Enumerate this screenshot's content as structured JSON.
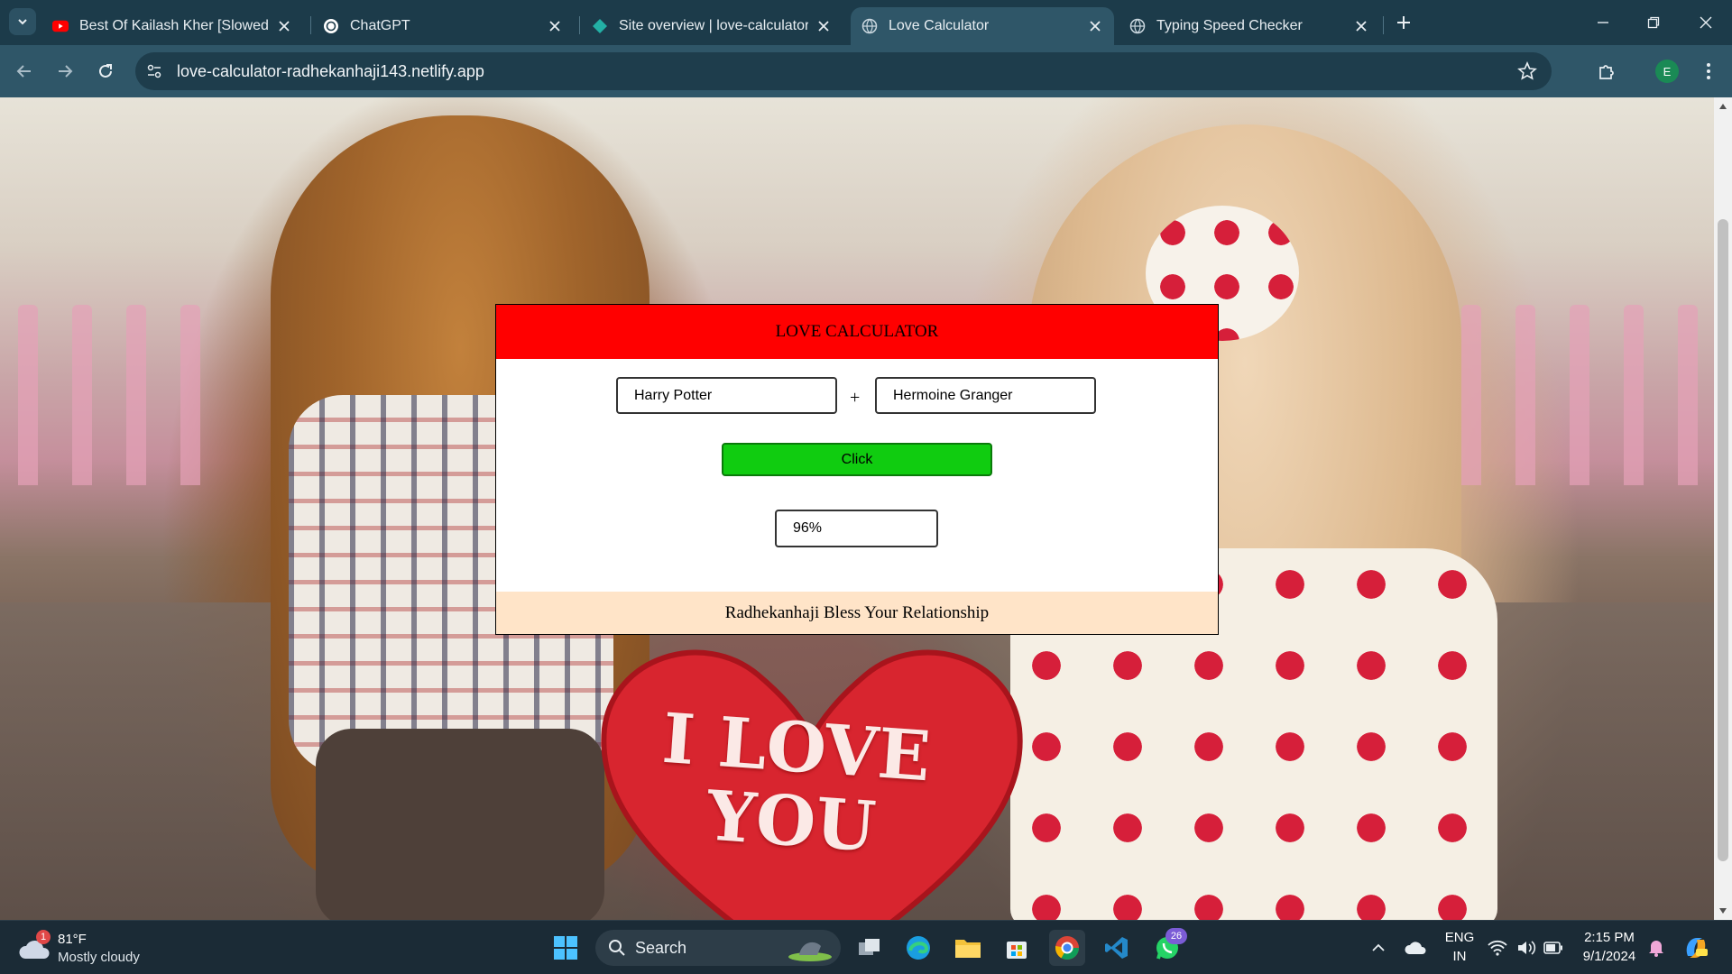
{
  "browser": {
    "tabs": [
      {
        "title": "Best Of Kailash Kher [Slowed +",
        "icon": "youtube-icon",
        "active": false
      },
      {
        "title": "ChatGPT",
        "icon": "chatgpt-icon",
        "active": false
      },
      {
        "title": "Site overview | love-calculator-r",
        "icon": "netlify-icon",
        "active": false
      },
      {
        "title": "Love Calculator",
        "icon": "globe-icon",
        "active": true
      },
      {
        "title": "Typing Speed Checker",
        "icon": "globe-icon",
        "active": false
      }
    ],
    "url": "love-calculator-radhekanhaji143.netlify.app",
    "profile_initial": "E"
  },
  "page": {
    "heart_text": "I LOVE YOU",
    "card": {
      "title": "LOVE CALCULATOR",
      "name1": "Harry Potter",
      "plus": "+",
      "name2": "Hermoine Granger",
      "button_label": "Click",
      "result": "96%",
      "footer": "Radhekanhaji Bless Your Relationship"
    }
  },
  "colors": {
    "header_red": "#ff0000",
    "button_green": "#10cc10",
    "footer_peach": "#ffe4c8",
    "tab_strip": "#1c3b4a",
    "toolbar": "#2f5668"
  },
  "taskbar": {
    "weather_temp": "81°F",
    "weather_condition": "Mostly cloudy",
    "weather_badge": "1",
    "search_label": "Search",
    "whatsapp_badge": "26",
    "language": "ENG",
    "region": "IN",
    "time": "2:15 PM",
    "date": "9/1/2024"
  }
}
